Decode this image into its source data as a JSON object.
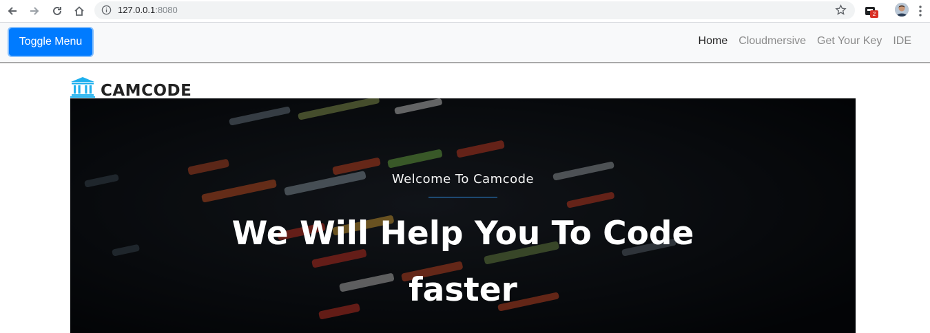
{
  "browser": {
    "url_host": "127.0.0.1",
    "url_port": ":8080",
    "extension_badge": "2"
  },
  "navbar": {
    "toggle_label": "Toggle Menu",
    "links": [
      {
        "label": "Home",
        "active": true
      },
      {
        "label": "Cloudmersive",
        "active": false
      },
      {
        "label": "Get Your Key",
        "active": false
      },
      {
        "label": "IDE",
        "active": false
      }
    ]
  },
  "logo": {
    "icon": "bank-icon",
    "text": "CAMCODE"
  },
  "hero": {
    "subtitle": "Welcome To Camcode",
    "headline": "We Will Help You To Code faster"
  },
  "colors": {
    "toggle_button": "#007bff",
    "logo_icon": "#1eb0ee",
    "hero_rule": "#2f8fe5"
  }
}
